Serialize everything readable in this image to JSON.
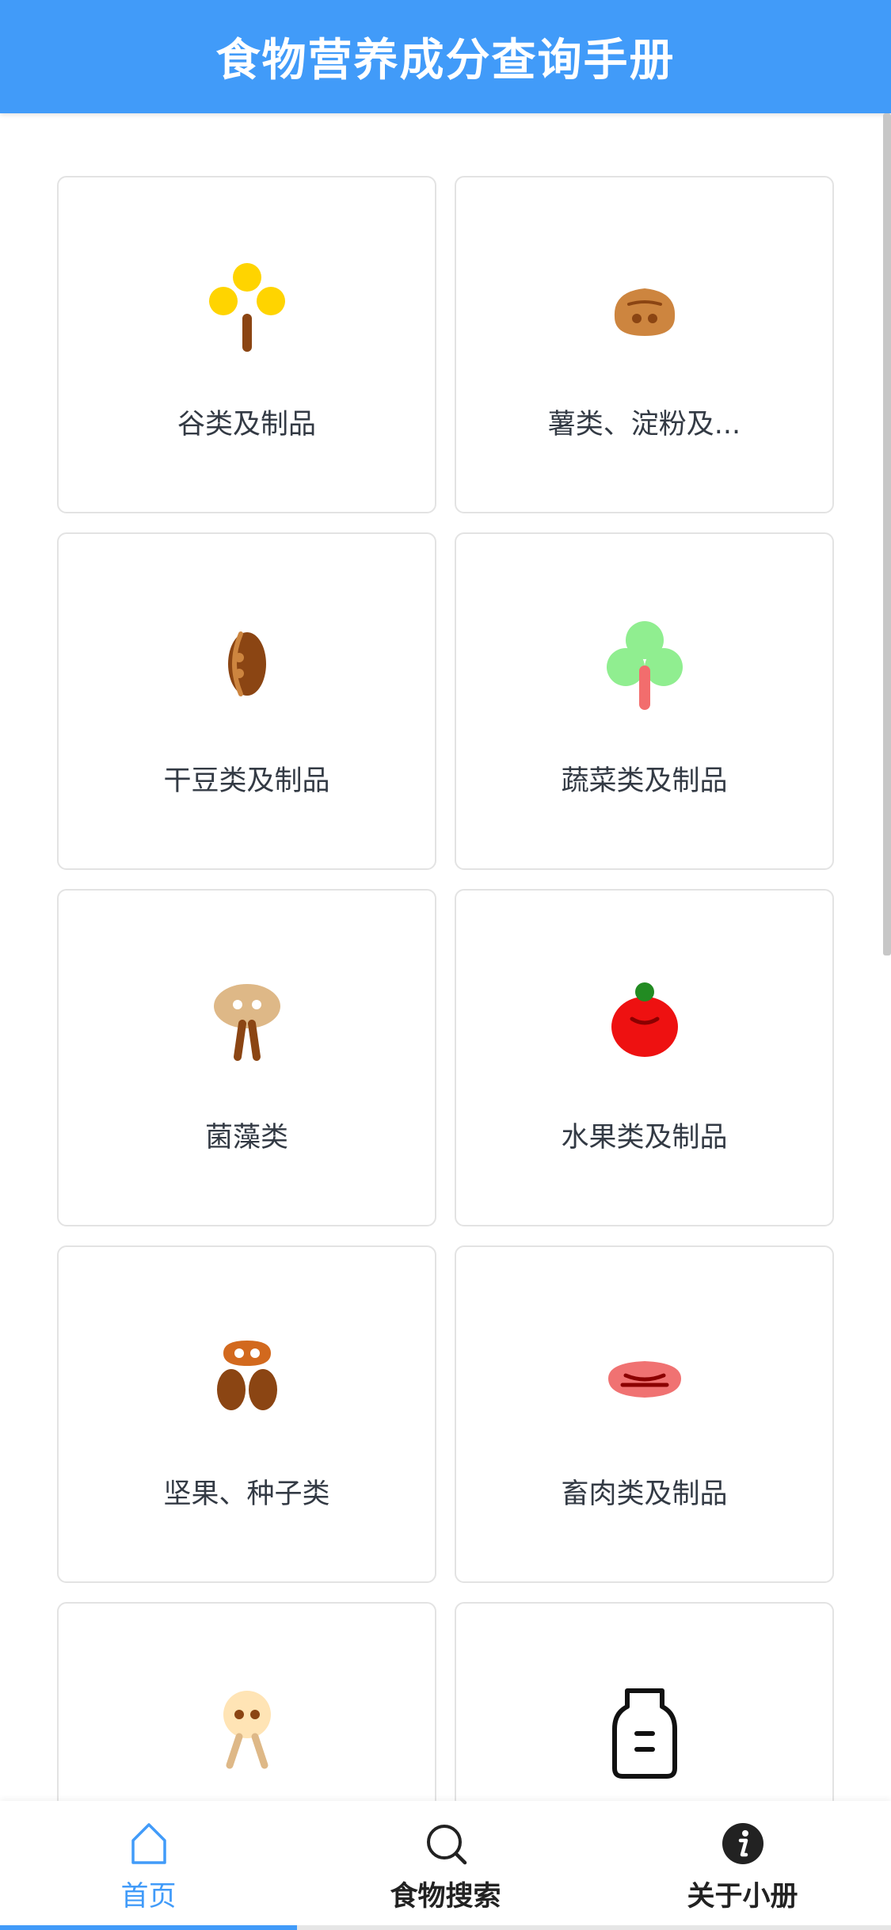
{
  "header": {
    "title": "食物营养成分查询手册"
  },
  "categories": [
    {
      "label": "谷类及制品",
      "icon": "grain-icon"
    },
    {
      "label": "薯类、淀粉及...",
      "icon": "potato-icon"
    },
    {
      "label": "干豆类及制品",
      "icon": "bean-icon"
    },
    {
      "label": "蔬菜类及制品",
      "icon": "vegetable-icon"
    },
    {
      "label": "菌藻类",
      "icon": "mushroom-icon"
    },
    {
      "label": "水果类及制品",
      "icon": "tomato-icon"
    },
    {
      "label": "坚果、种子类",
      "icon": "nut-icon"
    },
    {
      "label": "畜肉类及制品",
      "icon": "meat-icon"
    },
    {
      "label": "",
      "icon": "poultry-icon"
    },
    {
      "label": "",
      "icon": "milk-bottle-icon"
    }
  ],
  "tabbar": {
    "tabs": [
      {
        "label": "首页",
        "icon": "home-icon",
        "active": true
      },
      {
        "label": "食物搜索",
        "icon": "search-icon",
        "active": false
      },
      {
        "label": "关于小册",
        "icon": "info-icon",
        "active": false
      }
    ]
  },
  "colors": {
    "accent": "#419bf9",
    "card_border": "#e3e3e3",
    "label_text": "#333a44"
  }
}
